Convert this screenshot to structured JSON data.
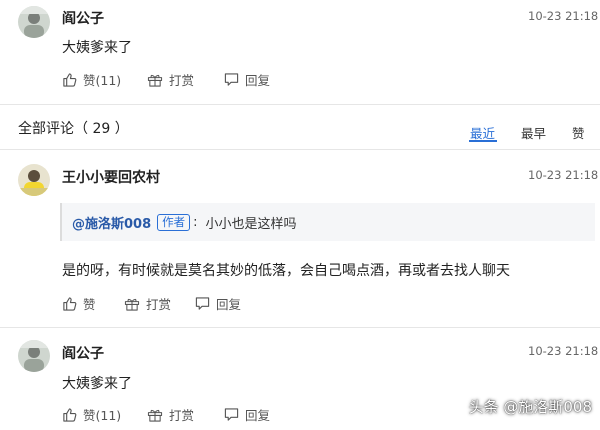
{
  "comment_top": {
    "username": "阎公子",
    "time": "10-23 21:18",
    "content": "大姨爹来了",
    "like_label": "赞(11)",
    "tip_label": "打赏",
    "reply_label": "回复"
  },
  "comments_header": {
    "title": "全部评论（ 29 ）",
    "sort_options": [
      "最近",
      "最早",
      "赞"
    ],
    "active_sort": "最近"
  },
  "comment_two": {
    "username": "王小小要回农村",
    "time": "10-23 21:18",
    "quote_name": "@施洛斯008",
    "quote_badge": "作者",
    "quote_colon": ":",
    "quote_text": "小小也是这样吗",
    "content": "是的呀，有时候就是莫名其妙的低落，会自己喝点酒，再或者去找人聊天",
    "like_label": "赞",
    "tip_label": "打赏",
    "reply_label": "回复"
  },
  "comment_three": {
    "username": "阎公子",
    "time": "10-23 21:18",
    "content": "大姨爹来了",
    "like_label": "赞(11)",
    "tip_label": "打赏",
    "reply_label": "回复"
  },
  "watermark": "头条 @施洛斯008",
  "colors": {
    "accent": "#2a6fd6",
    "quote_name": "#2a5aa8",
    "text": "#222222",
    "muted": "#666666",
    "separator": "#e6e6e6"
  },
  "icons": [
    "avatar",
    "thumb-up-icon",
    "gift-icon",
    "reply-icon"
  ]
}
